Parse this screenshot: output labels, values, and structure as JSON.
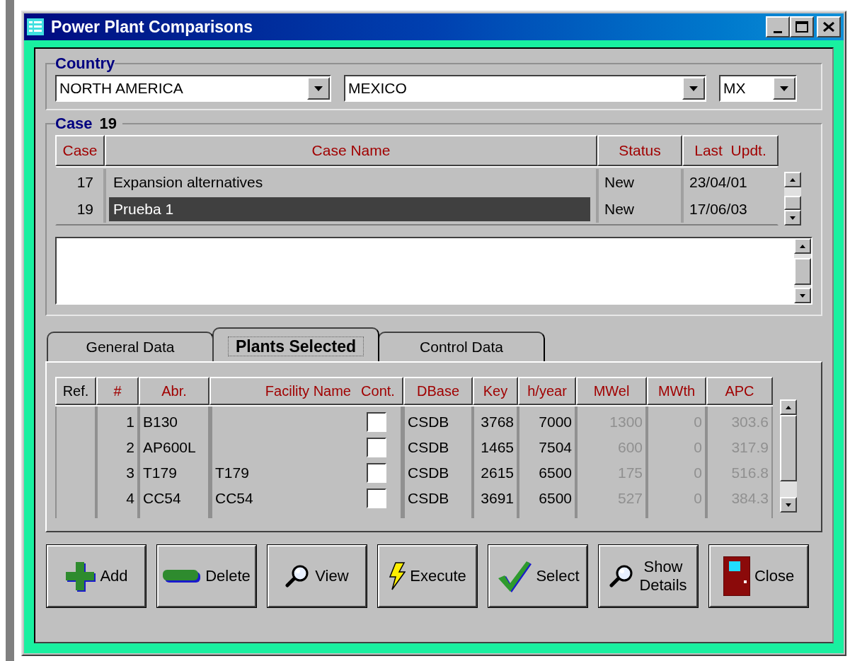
{
  "window": {
    "title": "Power Plant Comparisons"
  },
  "country": {
    "label": "Country",
    "region": "NORTH AMERICA",
    "country": "MEXICO",
    "code": "MX"
  },
  "case": {
    "label": "Case",
    "number": "19",
    "columns": [
      "Case",
      "Case Name",
      "Status",
      "Last  Updt."
    ],
    "rows": [
      {
        "case": "17",
        "name": "Expansion alternatives",
        "status": "New",
        "updated": "23/04/01",
        "selected": false
      },
      {
        "case": "19",
        "name": "Prueba 1",
        "status": "New",
        "updated": "17/06/03",
        "selected": true
      }
    ]
  },
  "tabs": [
    {
      "label": "General Data",
      "selected": false
    },
    {
      "label": "Plants Selected",
      "selected": true
    },
    {
      "label": "Control Data",
      "selected": false
    }
  ],
  "plants": {
    "columns": [
      {
        "kind": "text",
        "label": "Ref.",
        "color": "#000000"
      },
      {
        "kind": "number",
        "label": "#",
        "color": "#a00000",
        "dimmed": false
      },
      {
        "kind": "text",
        "label": "Abr.",
        "color": "#a00000",
        "dimmed": false
      },
      {
        "kind": "text",
        "label": "Facility Name",
        "color": "#a00000",
        "dimmed": false
      },
      {
        "kind": "checkbox",
        "label": "Cont.",
        "color": "#a00000"
      },
      {
        "kind": "text",
        "label": "DBase",
        "color": "#a00000",
        "dimmed": false
      },
      {
        "kind": "number",
        "label": "Key",
        "color": "#a00000",
        "dimmed": false
      },
      {
        "kind": "number",
        "label": "h/year",
        "color": "#a00000",
        "dimmed": false
      },
      {
        "kind": "number",
        "label": "MWel",
        "color": "#a00000",
        "dimmed": true
      },
      {
        "kind": "number",
        "label": "MWth",
        "color": "#a00000",
        "dimmed": true
      },
      {
        "kind": "number",
        "label": "APC",
        "color": "#a00000",
        "dimmed": true
      }
    ],
    "rows": [
      {
        "cells": [
          null,
          "1",
          "B130",
          null,
          null,
          "CSDB",
          "3768",
          "7000",
          "1300",
          "0",
          "303.6"
        ],
        "cont": false
      },
      {
        "cells": [
          null,
          "2",
          "AP600L",
          null,
          null,
          "CSDB",
          "1465",
          "7504",
          "600",
          "0",
          "317.9"
        ],
        "cont": false
      },
      {
        "cells": [
          null,
          "3",
          "T179",
          "T179",
          null,
          "CSDB",
          "2615",
          "6500",
          "175",
          "0",
          "516.8"
        ],
        "cont": false
      },
      {
        "cells": [
          null,
          "4",
          "CC54",
          "CC54",
          null,
          "CSDB",
          "3691",
          "6500",
          "527",
          "0",
          "384.3"
        ],
        "cont": false
      }
    ]
  },
  "buttons": [
    {
      "kind": "add",
      "label": "Add"
    },
    {
      "kind": "delete",
      "label": "Delete"
    },
    {
      "kind": "view",
      "label": "View"
    },
    {
      "kind": "execute",
      "label": "Execute"
    },
    {
      "kind": "select",
      "label": "Select"
    },
    {
      "kind": "details",
      "label": "Show\nDetails"
    },
    {
      "kind": "close",
      "label": "Close"
    }
  ]
}
